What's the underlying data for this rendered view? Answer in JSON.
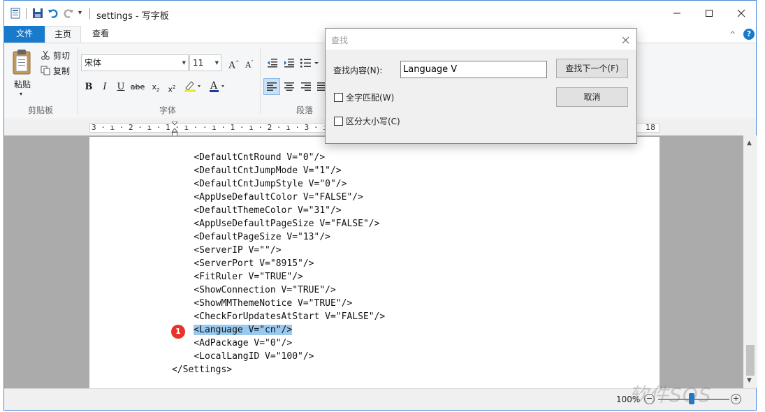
{
  "window": {
    "title": "settings - 写字板",
    "tabs": [
      {
        "label": "文件",
        "active": false
      },
      {
        "label": "主页",
        "active": true
      },
      {
        "label": "查看",
        "active": false
      }
    ]
  },
  "ribbon": {
    "clipboard": {
      "group_label": "剪贴板",
      "paste_label": "粘贴",
      "cut_label": "剪切",
      "copy_label": "复制"
    },
    "font": {
      "group_label": "字体",
      "font_name": "宋体",
      "font_size": "11"
    },
    "paragraph": {
      "group_label": "段落"
    }
  },
  "ruler": {
    "scale": "3 · ı · 2 · ı · 1 · ı ·   · ı · 1 · ı · 2 · ı · 3 · ı · 4 · ı · 5 · ı",
    "end_label": "18"
  },
  "document": {
    "lines": [
      "    <DefaultCntRound V=\"0\"/>",
      "    <DefaultCntJumpMode V=\"1\"/>",
      "    <DefaultCntJumpStyle V=\"0\"/>",
      "    <AppUseDefaultColor V=\"FALSE\"/>",
      "    <DefaultThemeColor V=\"31\"/>",
      "    <AppUseDefaultPageSize V=\"FALSE\"/>",
      "    <DefaultPageSize V=\"13\"/>",
      "    <ServerIP V=\"\"/>",
      "    <ServerPort V=\"8915\"/>",
      "    <FitRuler V=\"TRUE\"/>",
      "    <ShowConnection V=\"TRUE\"/>",
      "    <ShowMMThemeNotice V=\"TRUE\"/>",
      "    <CheckForUpdatesAtStart V=\"FALSE\"/>",
      "    <Language V=\"cn\"/>",
      "    <AdPackage V=\"0\"/>",
      "    <LocalLangID V=\"100\"/>",
      "</Settings>"
    ],
    "highlighted_line_index": 13,
    "marker_label": "1"
  },
  "statusbar": {
    "zoom": "100%",
    "zoom_out": "−",
    "zoom_in": "+"
  },
  "watermark": "软件SOS",
  "find_dialog": {
    "title": "查找",
    "find_label": "查找内容(N):",
    "find_value": "Language V",
    "find_next_label": "查找下一个(F)",
    "cancel_label": "取消",
    "match_whole_word_label": "全字匹配(W)",
    "match_case_label": "区分大小写(C)",
    "match_whole_word_checked": false,
    "match_case_checked": false
  },
  "colors": {
    "accent": "#1979ca",
    "selection": "#99c9ef",
    "marker": "#e8332a"
  }
}
